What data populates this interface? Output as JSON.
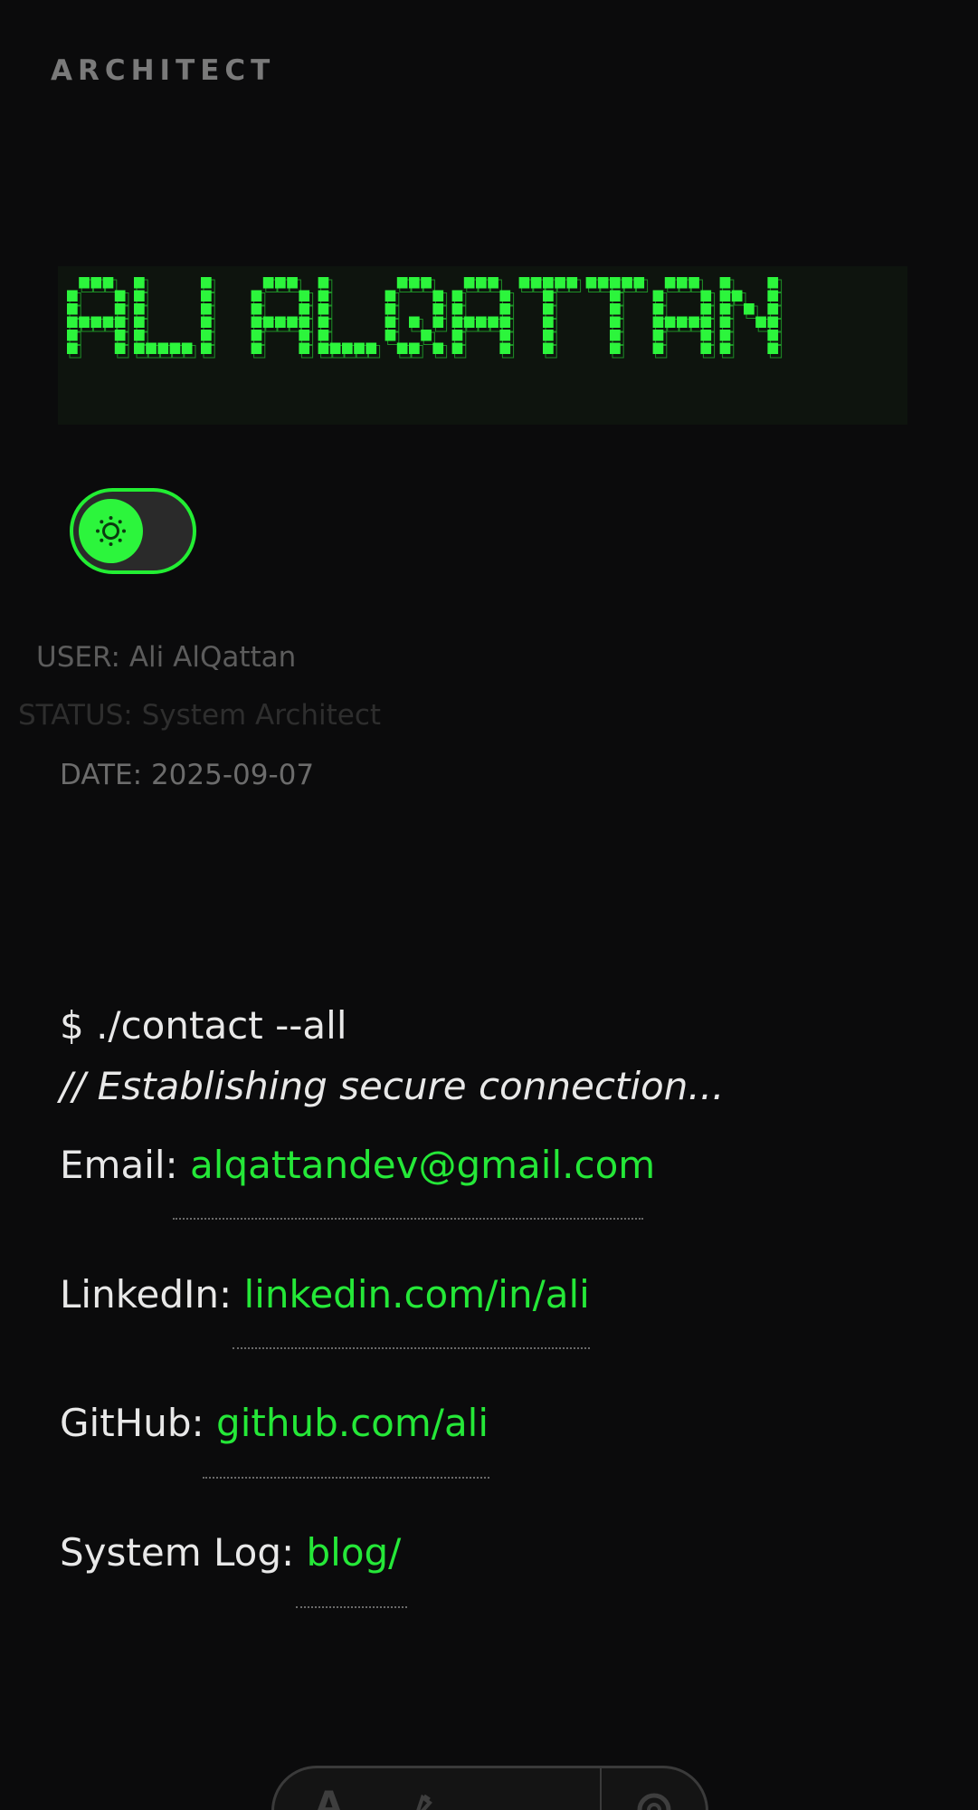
{
  "brand": {
    "label": "ARCHITECT"
  },
  "banner": {
    "name": "ALI ALQATTAN",
    "accent_color": "#2cf53c"
  },
  "theme_toggle": {
    "icon": "sun-icon",
    "state": "on"
  },
  "meta": {
    "user": "USER: Ali AlQattan",
    "status": "STATUS: System Architect",
    "date": "DATE: 2025-09-07"
  },
  "terminal": {
    "command": "$ ./contact --all",
    "comment": "// Establishing secure connection..."
  },
  "contacts": [
    {
      "label": "Email: ",
      "value": "alqattandev@gmail.com"
    },
    {
      "label": "LinkedIn: ",
      "value": "linkedin.com/in/ali"
    },
    {
      "label": "GitHub: ",
      "value": "github.com/ali"
    },
    {
      "label": "System Log: ",
      "value": "blog/"
    }
  ],
  "dock": {
    "items": [
      {
        "icon": "font-icon",
        "glyph": "A"
      },
      {
        "icon": "paint-icon"
      },
      {
        "icon": "menu-icon"
      },
      {
        "icon": "gear-icon"
      }
    ]
  }
}
